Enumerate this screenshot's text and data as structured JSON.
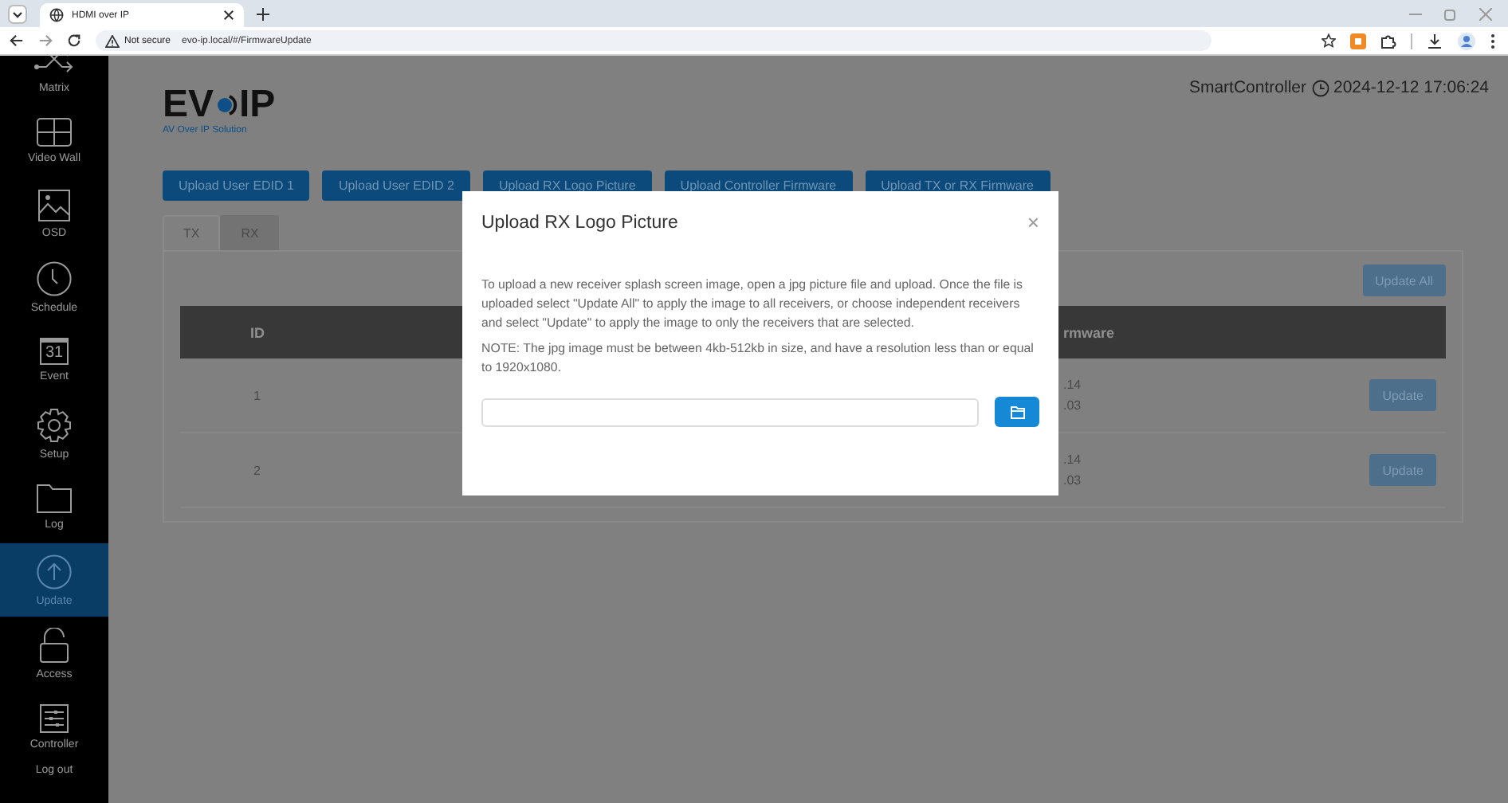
{
  "browser": {
    "tab_title": "HDMI over IP",
    "security": "Not secure",
    "url": "evo-ip.local/#/FirmwareUpdate"
  },
  "sidebar": {
    "items": [
      {
        "label": "Matrix",
        "kind": "matrix",
        "selected": false
      },
      {
        "label": "Video Wall",
        "kind": "wall",
        "selected": false
      },
      {
        "label": "OSD",
        "kind": "image",
        "selected": false
      },
      {
        "label": "Schedule",
        "kind": "clock",
        "selected": false
      },
      {
        "label": "Event",
        "kind": "calendar",
        "icon_text": "31",
        "selected": false
      },
      {
        "label": "Setup",
        "kind": "gear",
        "selected": false
      },
      {
        "label": "Log",
        "kind": "folder",
        "selected": false
      },
      {
        "label": "Update",
        "kind": "upload",
        "selected": true
      },
      {
        "label": "Access",
        "kind": "lock",
        "selected": false
      },
      {
        "label": "Controller",
        "kind": "sliders",
        "selected": false
      },
      {
        "label": "Log out",
        "kind": "text",
        "selected": false
      }
    ]
  },
  "header": {
    "logo_left": "EV",
    "logo_right": "IP",
    "tagline": "AV Over IP Solution",
    "device": "SmartController",
    "datetime": "2024-12-12 17:06:24"
  },
  "toolbar": [
    "Upload User EDID 1",
    "Upload User EDID 2",
    "Upload RX Logo Picture",
    "Upload Controller Firmware",
    "Upload TX or RX Firmware"
  ],
  "tabs": [
    {
      "label": "TX",
      "selected": true
    },
    {
      "label": "RX",
      "selected": false
    }
  ],
  "panel": {
    "update_all": "Update All",
    "columns": [
      "ID",
      "rmware"
    ],
    "rows": [
      {
        "id": "1",
        "firmware": [
          ".14",
          ".03"
        ],
        "action": "Update"
      },
      {
        "id": "2",
        "firmware": [
          ".14",
          ".03"
        ],
        "action": "Update"
      }
    ]
  },
  "modal": {
    "title": "Upload RX Logo Picture",
    "close": "×",
    "paragraphs": [
      "To upload a new receiver splash screen image, open a jpg picture file and upload. Once the file is uploaded select \"Update All\" to apply the image to all receivers, or choose independent receivers and select \"Update\" to apply the image to only the receivers that are selected.",
      "NOTE: The jpg image must be between 4kb-512kb in size, and have a resolution less than or equal to 1920x1080."
    ]
  }
}
